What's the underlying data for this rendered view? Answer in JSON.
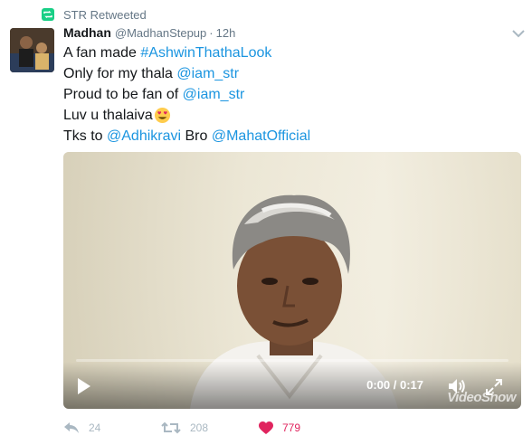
{
  "retweet_context": {
    "label": "STR Retweeted",
    "icon": "retweet-icon",
    "color": "#19cf86"
  },
  "tweet": {
    "author": {
      "name": "Madhan",
      "handle": "@MadhanStepup",
      "separator": "·",
      "time": "12h"
    },
    "lines": [
      {
        "plain": "A fan made ",
        "link": "#AshwinThathaLook"
      },
      {
        "plain": "Only for my thala ",
        "link": "@iam_str"
      },
      {
        "plain": "Proud to be fan of ",
        "link": "@iam_str"
      },
      {
        "plain": "Luv u thalaiva",
        "emoji": "heart-eyes-emoji"
      },
      {
        "plain": "Tks to ",
        "link": "@Adhikravi",
        "plain2": " Bro ",
        "link2": "@MahatOfficial"
      }
    ],
    "media": {
      "type": "video",
      "time_readout": "0:00 / 0:17",
      "progress": 0,
      "watermark": "VideoShow"
    },
    "actions": {
      "reply_count": "24",
      "retweet_count": "208",
      "like_count": "779"
    }
  },
  "colors": {
    "link": "#1b95e0",
    "muted": "#657786",
    "like": "#e0245e"
  }
}
